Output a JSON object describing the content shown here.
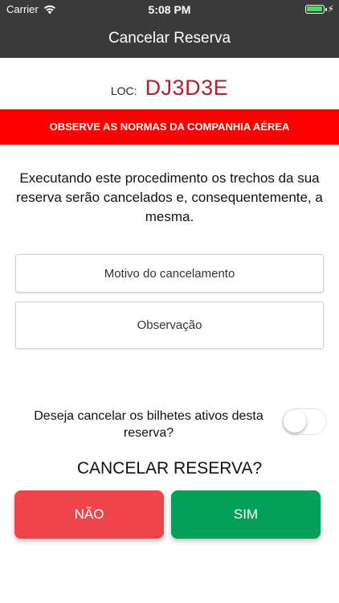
{
  "status_bar": {
    "carrier": "Carrier",
    "time": "5:08 PM",
    "battery_level": 0.95,
    "battery_color": "#4cd964"
  },
  "nav": {
    "title": "Cancelar Reserva"
  },
  "loc": {
    "label": "LOC:",
    "code": "DJ3D3E"
  },
  "warning": {
    "text": "OBSERVE AS NORMAS DA COMPANHIA AÉREA",
    "color": "#ff0000"
  },
  "info": {
    "text": "Executando este procedimento os trechos da sua reserva serão cancelados e, consequentemente,  a mesma."
  },
  "form": {
    "reason_placeholder": "Motivo do cancelamento",
    "notes_placeholder": "Observação"
  },
  "toggle": {
    "question": "Deseja cancelar os bilhetes ativos desta reserva?",
    "on": false
  },
  "confirm": {
    "question": "CANCELAR RESERVA?",
    "no_label": "NÃO",
    "yes_label": "SIM",
    "no_color": "#f0444b",
    "yes_color": "#03a05a"
  },
  "icons": {
    "wifi": "wifi-icon",
    "battery": "battery-icon",
    "charging": "charging-bolt-icon"
  }
}
